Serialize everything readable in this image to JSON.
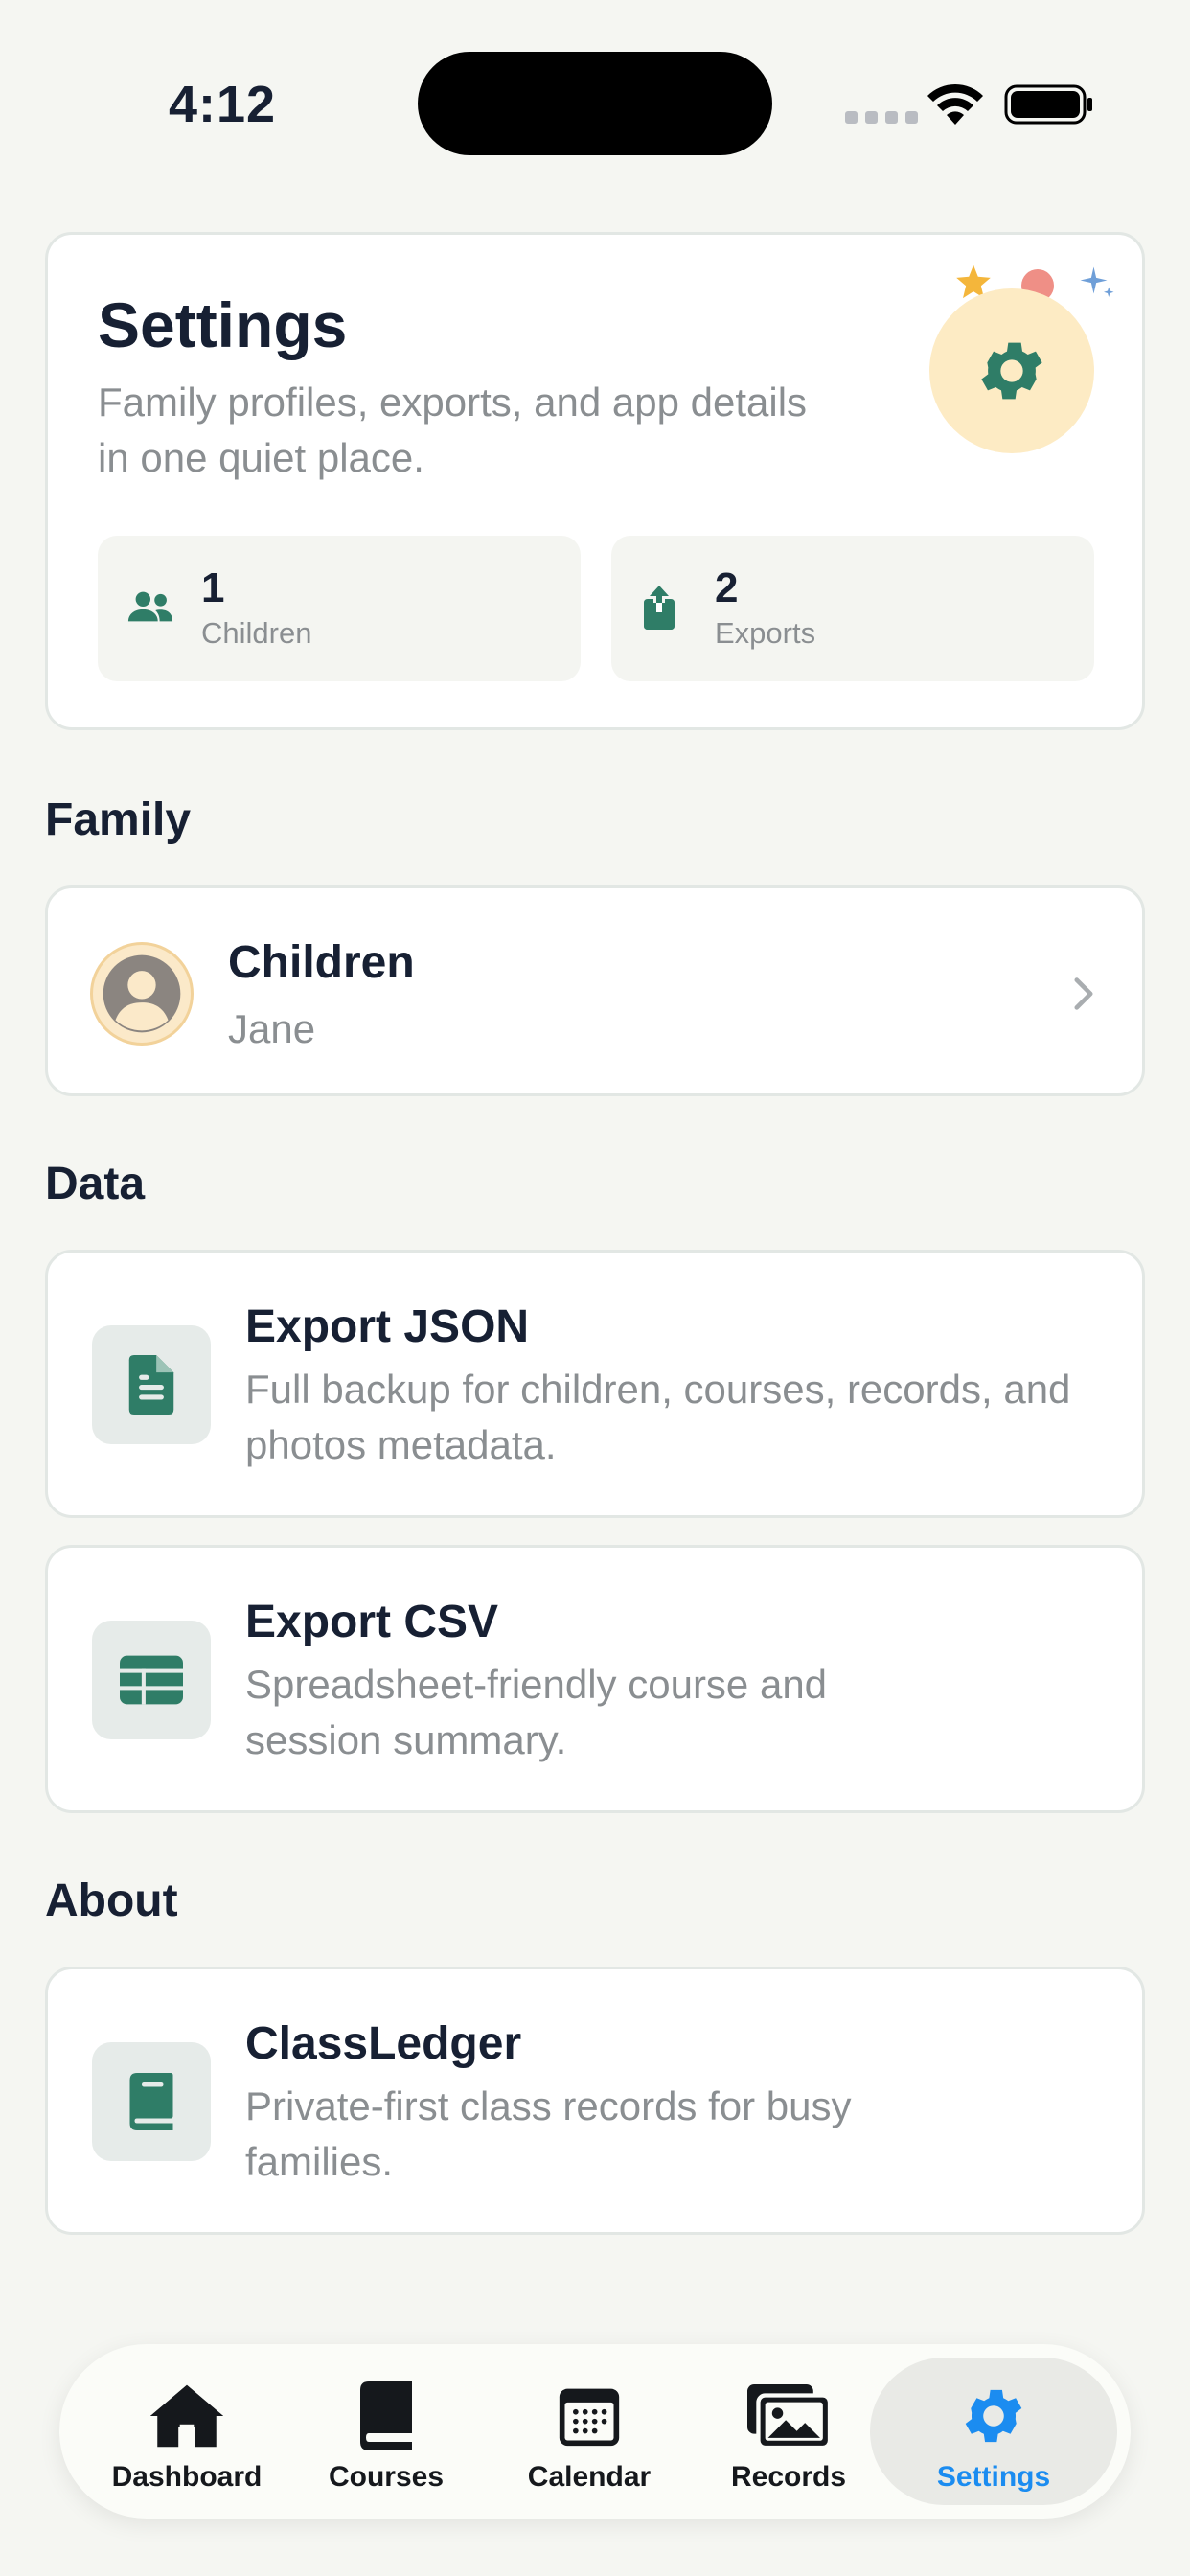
{
  "status_bar": {
    "time": "4:12"
  },
  "header": {
    "title": "Settings",
    "subtitle": "Family profiles, exports, and app details in one quiet place.",
    "stats": [
      {
        "value": "1",
        "label": "Children",
        "icon": "people-icon"
      },
      {
        "value": "2",
        "label": "Exports",
        "icon": "export-icon"
      }
    ]
  },
  "sections": {
    "family": "Family",
    "data": "Data",
    "about": "About"
  },
  "family": {
    "title": "Children",
    "subtitle": "Jane"
  },
  "data": {
    "json": {
      "title": "Export JSON",
      "subtitle": "Full backup for children, courses, records, and photos metadata."
    },
    "csv": {
      "title": "Export CSV",
      "subtitle": "Spreadsheet-friendly course and session summary."
    }
  },
  "about": {
    "title": "ClassLedger",
    "subtitle": "Private-first class records for busy families."
  },
  "tabbar": {
    "items": [
      {
        "label": "Dashboard",
        "icon": "home-icon"
      },
      {
        "label": "Courses",
        "icon": "book-icon"
      },
      {
        "label": "Calendar",
        "icon": "calendar-icon"
      },
      {
        "label": "Records",
        "icon": "photos-icon"
      },
      {
        "label": "Settings",
        "icon": "gear-icon"
      }
    ],
    "active": "Settings"
  },
  "colors": {
    "accent_green": "#2f7d67",
    "active_tab_blue": "#1b8cf0",
    "background": "#f5f6f2"
  }
}
